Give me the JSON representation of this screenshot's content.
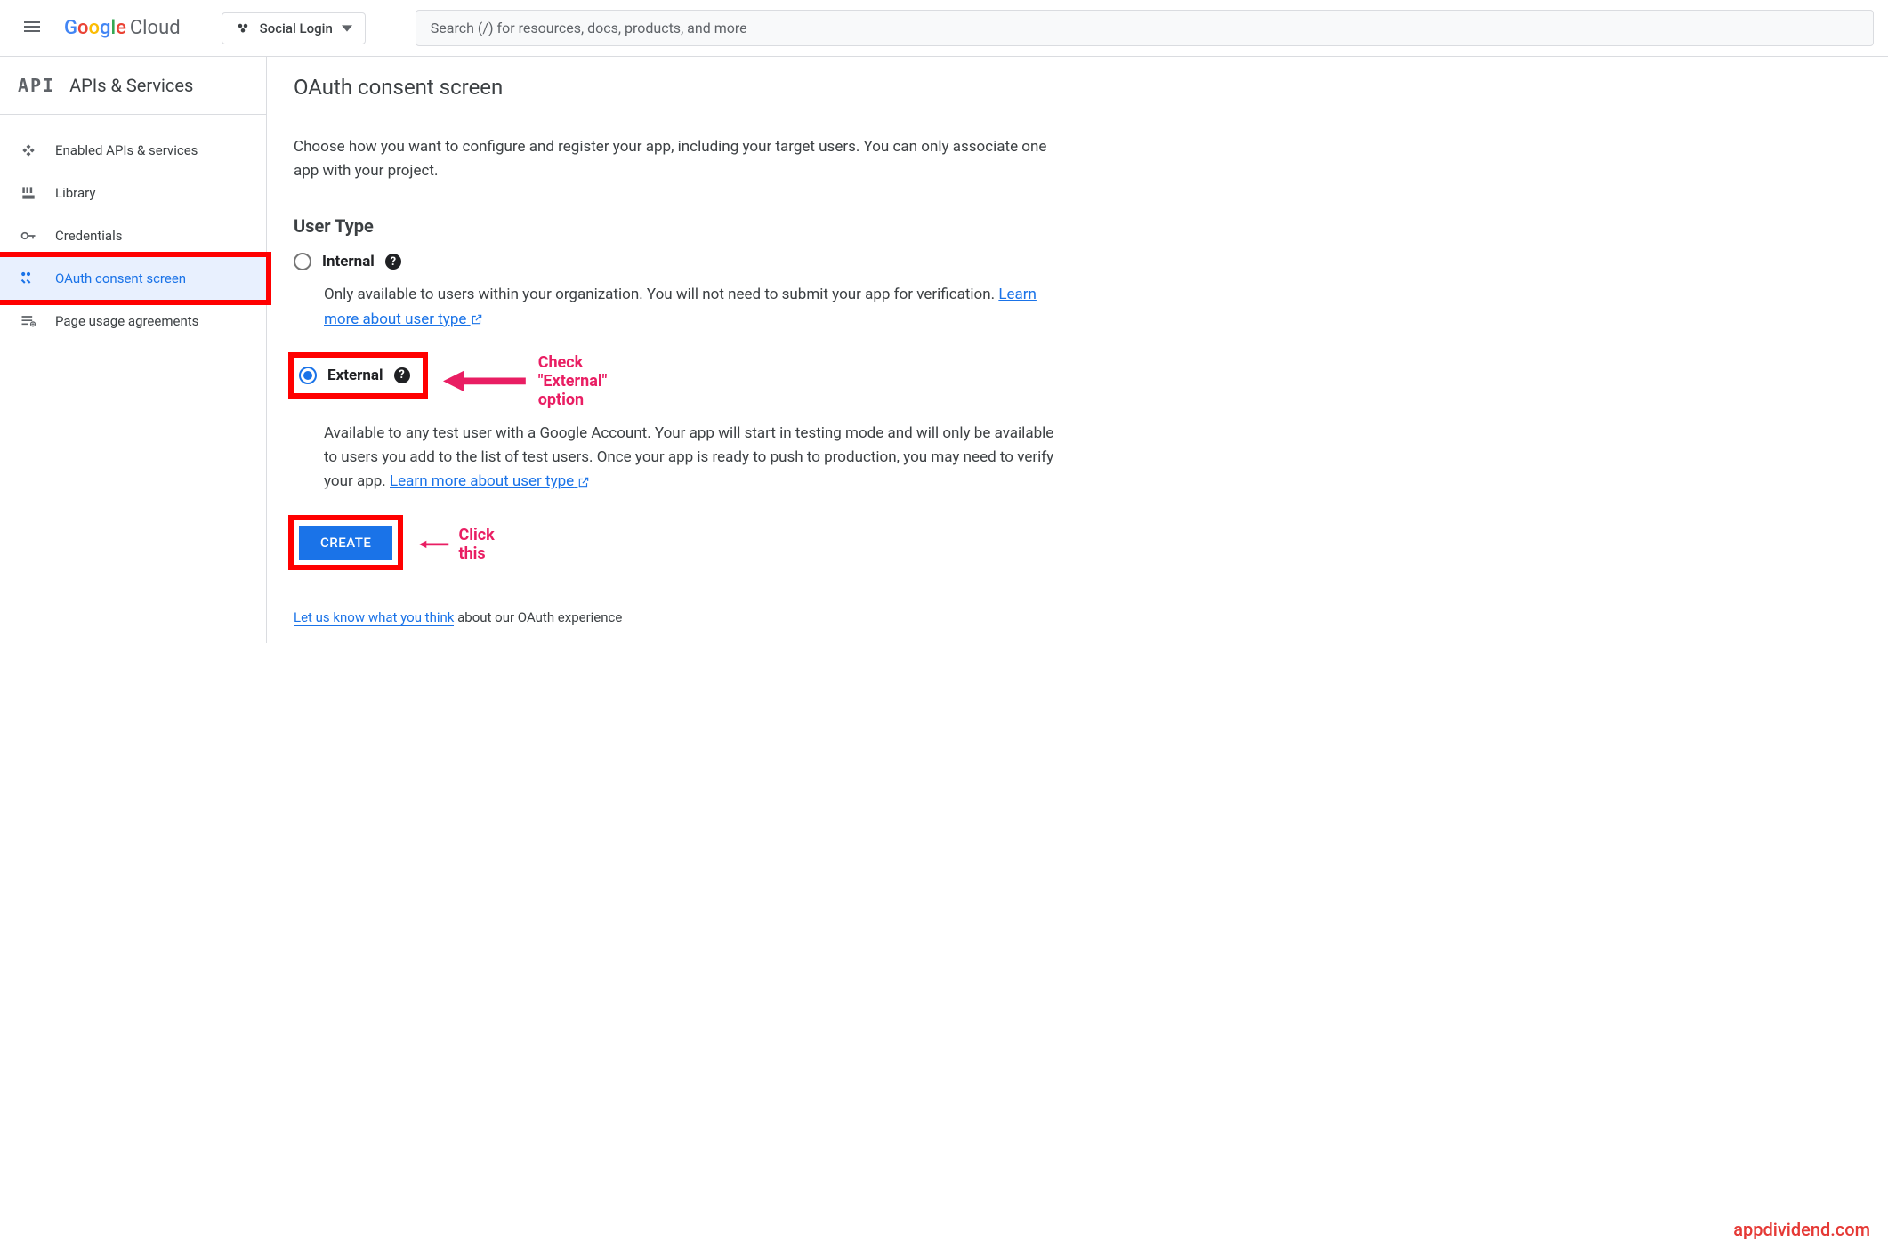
{
  "header": {
    "logo_cloud": "Cloud",
    "project_name": "Social Login",
    "search_placeholder": "Search (/) for resources, docs, products, and more"
  },
  "sidebar": {
    "title": "APIs & Services",
    "items": [
      {
        "label": "Enabled APIs & services"
      },
      {
        "label": "Library"
      },
      {
        "label": "Credentials"
      },
      {
        "label": "OAuth consent screen"
      },
      {
        "label": "Page usage agreements"
      }
    ]
  },
  "main": {
    "title": "OAuth consent screen",
    "intro": "Choose how you want to configure and register your app, including your target users. You can only associate one app with your project.",
    "section_title": "User Type",
    "internal": {
      "label": "Internal",
      "desc": "Only available to users within your organization. You will not need to submit your app for verification. ",
      "link": "Learn more about user type"
    },
    "external": {
      "label": "External",
      "desc": "Available to any test user with a Google Account. Your app will start in testing mode and will only be available to users you add to the list of test users. Once your app is ready to push to production, you may need to verify your app. ",
      "link": "Learn more about user type"
    },
    "create_label": "CREATE",
    "feedback_link": "Let us know what you think",
    "feedback_rest": " about our OAuth experience"
  },
  "annotations": {
    "external": "Check \"External\" option",
    "create": "Click this"
  },
  "watermark": "appdividend.com"
}
